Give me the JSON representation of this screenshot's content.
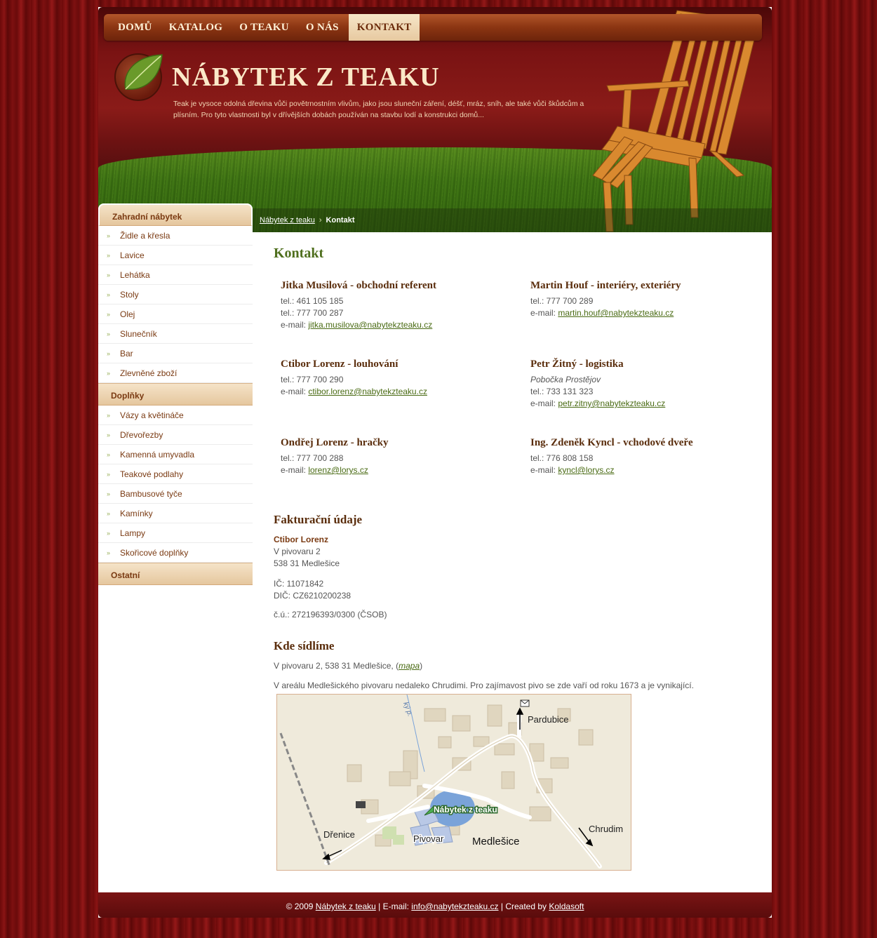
{
  "nav": {
    "items": [
      {
        "label": "DOMŮ"
      },
      {
        "label": "KATALOG"
      },
      {
        "label": "O TEAKU"
      },
      {
        "label": "O NÁS"
      },
      {
        "label": "KONTAKT",
        "active": true
      }
    ]
  },
  "header": {
    "title": "NÁBYTEK Z TEAKU",
    "intro": "Teak je vysoce odolná dřevina vůči povětrnostním vlivům, jako jsou sluneční záření, déšť, mráz, sníh, ale také vůči škůdcům a plísním. Pro tyto vlastnosti byl v dřívějších dobách používán na stavbu lodí a konstrukci domů..."
  },
  "breadcrumb": {
    "home": "Nábytek z teaku",
    "separator": "›",
    "current": "Kontakt"
  },
  "sidebar": {
    "categories": [
      {
        "title": "Zahradní nábytek",
        "items": [
          "Židle a křesla",
          "Lavice",
          "Lehátka",
          "Stoly",
          "Olej",
          "Slunečník",
          "Bar",
          "Zlevněné zboží"
        ]
      },
      {
        "title": "Doplňky",
        "items": [
          "Vázy a květináče",
          "Dřevořezby",
          "Kamenná umyvadla",
          "Teakové podlahy",
          "Bambusové tyče",
          "Kamínky",
          "Lampy",
          "Skořicové doplňky"
        ]
      },
      {
        "title": "Ostatní",
        "items": []
      }
    ]
  },
  "main": {
    "title": "Kontakt",
    "contacts": [
      {
        "name": "Jitka Musilová - obchodní referent",
        "branch": "",
        "lines": [
          "tel.: 461 105 185",
          "tel.: 777 700 287"
        ],
        "email_label": "e-mail: ",
        "email": "jitka.musilova@nabytekzteaku.cz"
      },
      {
        "name": "Martin Houf - interiéry, exteriéry",
        "branch": "",
        "lines": [
          "tel.: 777 700 289"
        ],
        "email_label": "e-mail: ",
        "email": "martin.houf@nabytekzteaku.cz"
      },
      {
        "name": "Ctibor Lorenz - louhování",
        "branch": "",
        "lines": [
          "tel.: 777 700 290"
        ],
        "email_label": "e-mail: ",
        "email": "ctibor.lorenz@nabytekzteaku.cz"
      },
      {
        "name": "Petr Žitný - logistika",
        "branch": "Pobočka Prostějov",
        "lines": [
          "tel.: 733 131 323"
        ],
        "email_label": "e-mail: ",
        "email": "petr.zitny@nabytekzteaku.cz"
      },
      {
        "name": "Ondřej Lorenz - hračky",
        "branch": "",
        "lines": [
          "tel.: 777 700 288"
        ],
        "email_label": "e-mail: ",
        "email": "lorenz@lorys.cz"
      },
      {
        "name": "Ing. Zdeněk Kyncl - vchodové dveře",
        "branch": "",
        "lines": [
          "tel.: 776 808 158"
        ],
        "email_label": "e-mail: ",
        "email": "kyncl@lorys.cz"
      }
    ],
    "billing": {
      "title": "Fakturační údaje",
      "name": "Ctibor Lorenz",
      "street": "V pivovaru 2",
      "city": "538 31 Medlešice",
      "ic": "IČ: 11071842",
      "dic": "DIČ: CZ6210200238",
      "account": "č.ú.: 272196393/0300 (ČSOB)"
    },
    "location": {
      "title": "Kde sídlíme",
      "address": "V pivovaru 2, 538 31 Medlešice, ",
      "map_link": "mapa",
      "description": "V areálu Medlešického pivovaru nedaleko Chrudimi. Pro zajímavost pivo se zde vaří od roku 1673 a je vynikající."
    }
  },
  "map": {
    "labels": {
      "pardubice": "Pardubice",
      "nabytek": "Nábytek z teaku",
      "drenice": "Dřenice",
      "pivovar": "Pivovar",
      "medlesice": "Medlešice",
      "chrudim": "Chrudim",
      "stream": "ký p."
    }
  },
  "footer": {
    "copyright": "© 2009 ",
    "site_link": "Nábytek z teaku",
    "email_prefix": " | E-mail: ",
    "email": "info@nabytekzteaku.cz",
    "created_prefix": " | Created by ",
    "author": "Koldasoft"
  },
  "colors": {
    "accent_green": "#4f6f1e",
    "heading_brown": "#5a2d0c",
    "nav_active_bg": "#f6e6c8",
    "footer_bg": "#7a1414"
  }
}
